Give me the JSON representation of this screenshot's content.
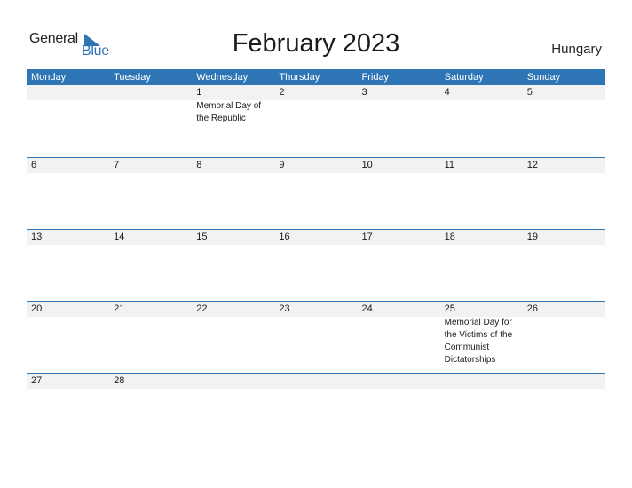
{
  "logo": {
    "word1": "General",
    "word2": "Blue",
    "icon": "triangle-flag-icon"
  },
  "title": "February 2023",
  "country": "Hungary",
  "colors": {
    "accent": "#2e75b6",
    "strip": "#f2f2f2"
  },
  "weekdays": [
    "Monday",
    "Tuesday",
    "Wednesday",
    "Thursday",
    "Friday",
    "Saturday",
    "Sunday"
  ],
  "weeks": [
    {
      "days": [
        "",
        "",
        "1",
        "2",
        "3",
        "4",
        "5"
      ],
      "events": [
        "",
        "",
        "Memorial Day of the Republic",
        "",
        "",
        "",
        ""
      ]
    },
    {
      "days": [
        "6",
        "7",
        "8",
        "9",
        "10",
        "11",
        "12"
      ],
      "events": [
        "",
        "",
        "",
        "",
        "",
        "",
        ""
      ]
    },
    {
      "days": [
        "13",
        "14",
        "15",
        "16",
        "17",
        "18",
        "19"
      ],
      "events": [
        "",
        "",
        "",
        "",
        "",
        "",
        ""
      ]
    },
    {
      "days": [
        "20",
        "21",
        "22",
        "23",
        "24",
        "25",
        "26"
      ],
      "events": [
        "",
        "",
        "",
        "",
        "",
        "Memorial Day for the Victims of the Communist Dictatorships",
        ""
      ]
    },
    {
      "days": [
        "27",
        "28",
        "",
        "",
        "",
        "",
        ""
      ],
      "events": [
        "",
        "",
        "",
        "",
        "",
        "",
        ""
      ]
    }
  ]
}
